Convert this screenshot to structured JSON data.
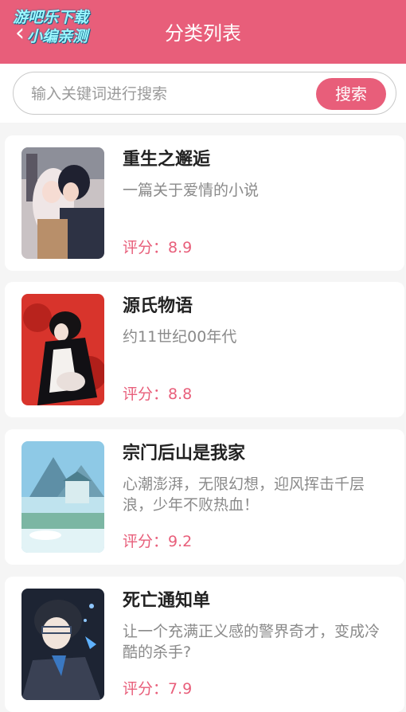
{
  "header": {
    "back_icon": "chevron-left-icon",
    "title": "分类列表",
    "watermark_line1": "游吧乐下载",
    "watermark_line2": "小编亲测",
    "color": "#e85e7a"
  },
  "search": {
    "placeholder": "输入关键词进行搜索",
    "value": "",
    "button_label": "搜索"
  },
  "books": [
    {
      "title": "重生之邂逅",
      "desc": "一篇关于爱情的小说",
      "rating": "评分：8.9"
    },
    {
      "title": "源氏物语",
      "desc": "约11世纪00年代",
      "rating": "评分：8.8"
    },
    {
      "title": "宗门后山是我家",
      "desc": "心潮澎湃，无限幻想，迎风挥击千层浪，少年不败热血！",
      "rating": "评分：9.2"
    },
    {
      "title": "死亡通知单",
      "desc": "让一个充满正义感的警界奇才，变成冷酷的杀手?",
      "rating": "评分：7.9"
    }
  ]
}
